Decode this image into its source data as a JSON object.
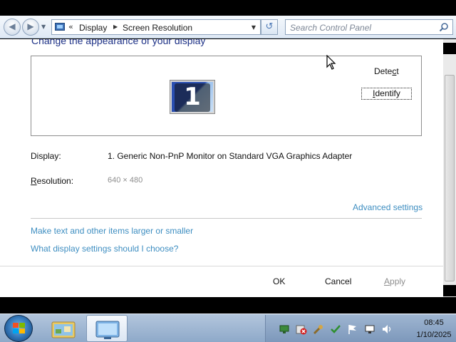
{
  "address_bar": {
    "chevron": "«",
    "breadcrumbs": [
      "Display",
      "Screen Resolution"
    ],
    "search_placeholder": "Search Control Panel"
  },
  "content": {
    "heading": "Change the appearance of your display",
    "monitor_number": "1",
    "detect_label": {
      "pre": "Dete",
      "key": "c",
      "post": "t"
    },
    "identify_label": {
      "pre": "",
      "key": "I",
      "post": "dentify"
    },
    "display_label": "Display:",
    "display_value": "1. Generic Non-PnP Monitor on Standard VGA Graphics Adapter",
    "resolution_label": {
      "pre": "",
      "key": "R",
      "post": "esolution:"
    },
    "resolution_value": "640 × 480",
    "advanced_link": "Advanced settings",
    "links": [
      "Make text and other items larger or smaller",
      "What display settings should I choose?"
    ],
    "buttons": {
      "ok": "OK",
      "cancel": "Cancel",
      "apply": {
        "pre": "",
        "key": "A",
        "post": "pply"
      }
    }
  },
  "taskbar": {
    "clock_time": "08:45",
    "clock_date": "1/10/2025",
    "tray_icons": [
      "network-icon",
      "security-alert-icon",
      "tools-icon",
      "checkmark-icon",
      "flag-icon",
      "display-icon",
      "volume-icon"
    ]
  },
  "colors": {
    "link": "#3e8ec1",
    "heading": "#1e3287",
    "disabled_text": "#8e8e8e"
  }
}
